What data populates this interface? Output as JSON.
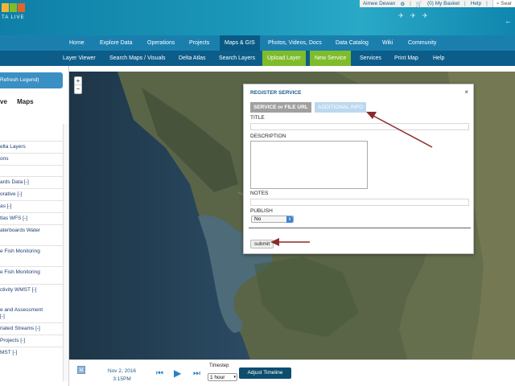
{
  "header": {
    "logo_text": "TA LIVE",
    "user_name": "Aimee Dewan",
    "basket": "(0) My Basket",
    "help": "Help",
    "search": "Sear",
    "colors": {
      "logo_1": "#f2b632",
      "logo_2": "#7ebc2c",
      "logo_3": "#e1652a"
    }
  },
  "nav_primary": {
    "items": [
      "Home",
      "Explore Data",
      "Operations",
      "Projects",
      "Maps & GIS",
      "Photos, Videos, Docs",
      "Data Catalog",
      "Wiki",
      "Community"
    ],
    "active": "Maps & GIS"
  },
  "nav_secondary": {
    "items": [
      "Layer Viewer",
      "Search Maps / Visuals",
      "Delta Atlas",
      "Search Layers",
      "Upload Layer",
      "New Service",
      "Services",
      "Print Map",
      "Help"
    ],
    "highlighted": [
      "Upload Layer",
      "New Service"
    ]
  },
  "sidebar": {
    "legend_button": "Refresh Legend)",
    "tabs": [
      "ve",
      "Maps"
    ],
    "layers": [
      "elta Layers",
      "ons",
      "",
      "ards Data [-]",
      "orative [-]",
      "as [-]",
      "tlas WFS [-]",
      "aterboards Water",
      "e Fish Monitoring",
      "e Fish Monitoring",
      "ctivity WMST [-]",
      "e and Assessment",
      "[-]",
      "riated Streams [-]",
      "Projects [-]",
      "MST [-]"
    ]
  },
  "map": {
    "zoom_in": "+",
    "zoom_out": "−"
  },
  "dialog": {
    "title": "REGISTER SERVICE",
    "close": "×",
    "tab_service": "SERVICE or FILE URL",
    "tab_additional": "ADDITIONAL INFO",
    "label_title": "TITLE",
    "label_description": "DESCRIPTION",
    "label_notes": "NOTES",
    "label_publish": "PUBLISH",
    "publish_value": "No",
    "submit": "submit"
  },
  "timeline": {
    "m_button": "M",
    "date": "Nov 2, 2016",
    "time": "3:15PM",
    "timestep_label": "Timestep",
    "timestep_value": "1 hour",
    "adjust_button": "Adjust Timeline"
  },
  "annotation_color": "#8b2a2a"
}
